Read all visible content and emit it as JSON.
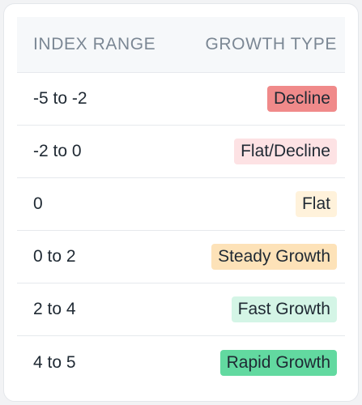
{
  "table": {
    "headers": {
      "index_range": "INDEX RANGE",
      "growth_type": "GROWTH TYPE"
    },
    "rows": [
      {
        "range": "-5 to -2",
        "type": "Decline",
        "badge_color": "#f08a8a"
      },
      {
        "range": "-2 to 0",
        "type": "Flat/Decline",
        "badge_color": "#fde2e4"
      },
      {
        "range": "0",
        "type": "Flat",
        "badge_color": "#fff2db"
      },
      {
        "range": "0 to 2",
        "type": "Steady Growth",
        "badge_color": "#fde2b8"
      },
      {
        "range": "2 to 4",
        "type": "Fast Growth",
        "badge_color": "#d4f5e6"
      },
      {
        "range": "4 to 5",
        "type": "Rapid Growth",
        "badge_color": "#62d9a0"
      }
    ]
  }
}
